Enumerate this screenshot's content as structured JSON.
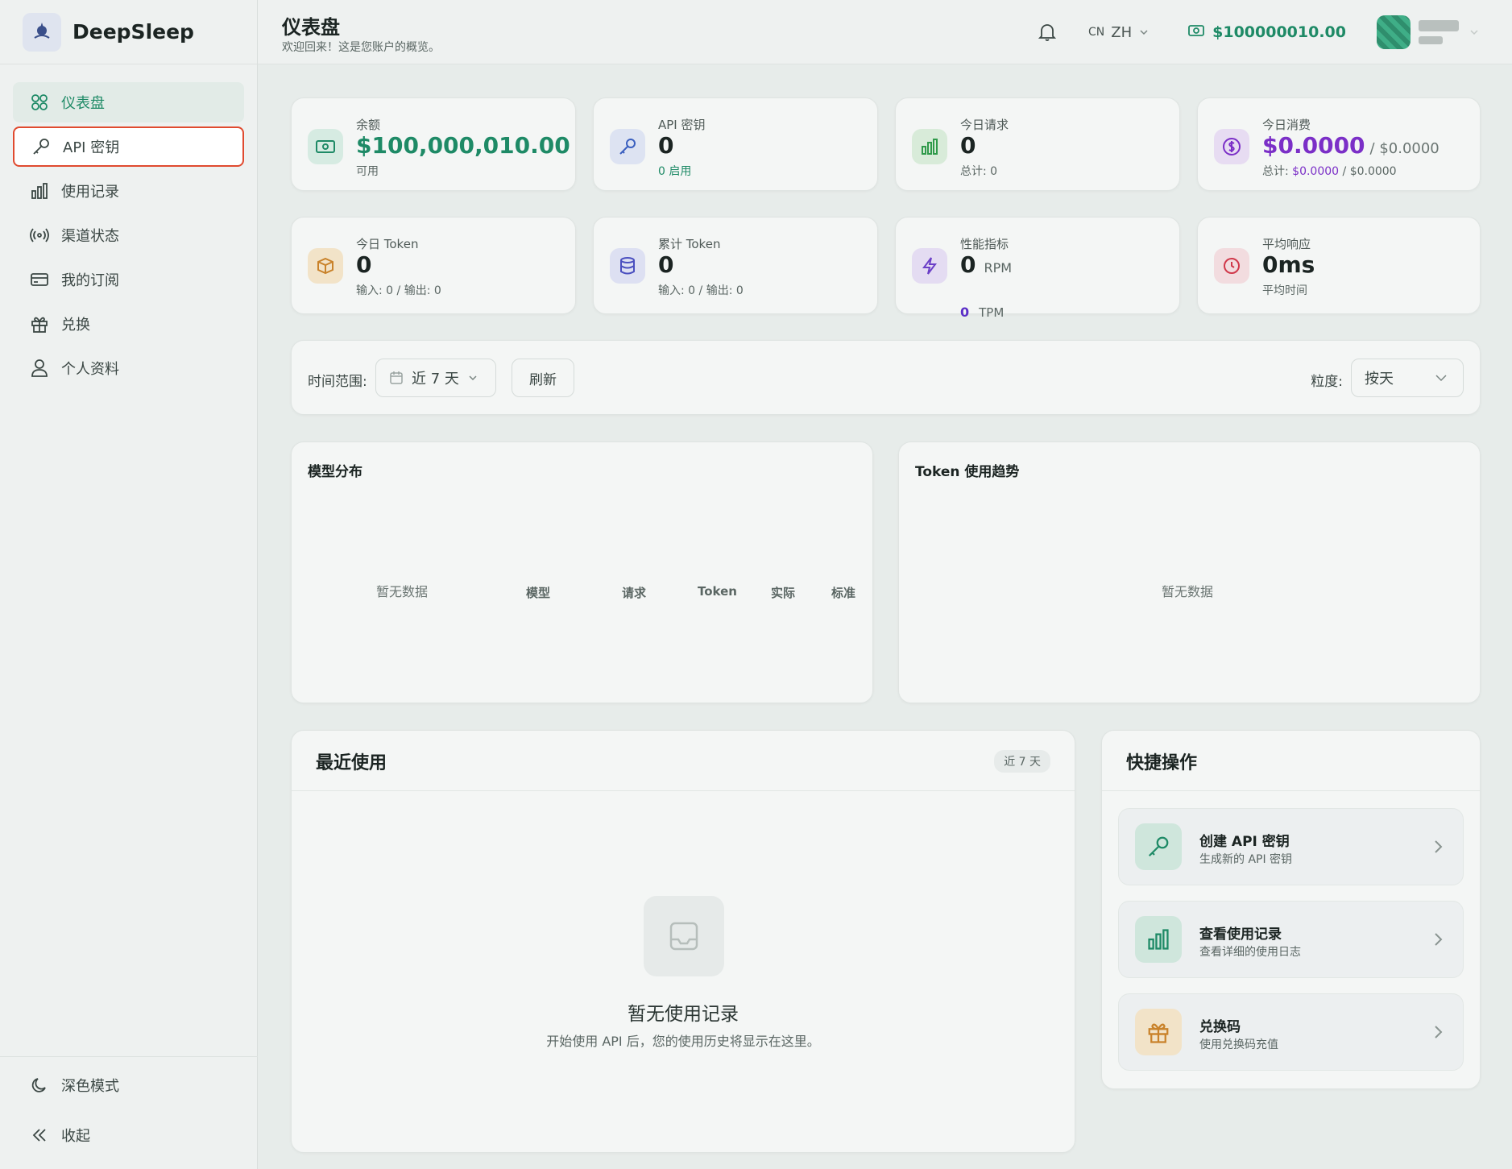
{
  "app": {
    "name": "DeepSleep"
  },
  "sidebar": {
    "items": [
      {
        "label": "仪表盘"
      },
      {
        "label": "API 密钥"
      },
      {
        "label": "使用记录"
      },
      {
        "label": "渠道状态"
      },
      {
        "label": "我的订阅"
      },
      {
        "label": "兑换"
      },
      {
        "label": "个人资料"
      }
    ],
    "bottom": {
      "dark_mode": "深色模式",
      "collapse": "收起"
    }
  },
  "header": {
    "title": "仪表盘",
    "subtitle": "欢迎回来！这是您账户的概览。",
    "lang_code": "CN",
    "lang": "ZH",
    "balance": "$100000010.00"
  },
  "stats": {
    "balance": {
      "label": "余额",
      "value": "$100,000,010.00",
      "sub": "可用"
    },
    "api_keys": {
      "label": "API 密钥",
      "value": "0",
      "sub": "0 启用"
    },
    "today_requests": {
      "label": "今日请求",
      "value": "0",
      "sub": "总计: 0"
    },
    "today_cost": {
      "label": "今日消费",
      "value": "$0.0000",
      "suffix": "/ $0.0000",
      "sub_prefix": "总计:",
      "sub_value": "$0.0000",
      "sub_suffix": "/ $0.0000"
    },
    "today_token": {
      "label": "今日 Token",
      "value": "0",
      "sub": "输入: 0 / 输出: 0"
    },
    "total_token": {
      "label": "累计 Token",
      "value": "0",
      "sub": "输入: 0 / 输出: 0"
    },
    "performance": {
      "label": "性能指标",
      "rpm_value": "0",
      "rpm_unit": "RPM",
      "tpm_value": "0",
      "tpm_unit": "TPM"
    },
    "avg_response": {
      "label": "平均响应",
      "value": "0ms",
      "sub": "平均时间"
    }
  },
  "filter": {
    "range_label": "时间范围:",
    "range_value": "近 7 天",
    "refresh": "刷新",
    "granularity_label": "粒度:",
    "granularity_value": "按天"
  },
  "model_dist": {
    "title": "模型分布",
    "empty": "暂无数据",
    "columns": [
      "模型",
      "请求",
      "Token",
      "实际",
      "标准"
    ]
  },
  "token_trend": {
    "title": "Token 使用趋势",
    "empty": "暂无数据"
  },
  "recent": {
    "title": "最近使用",
    "chip": "近 7 天",
    "empty_title": "暂无使用记录",
    "empty_sub": "开始使用 API 后，您的使用历史将显示在这里。"
  },
  "quick": {
    "title": "快捷操作",
    "items": [
      {
        "title": "创建 API 密钥",
        "sub": "生成新的 API 密钥"
      },
      {
        "title": "查看使用记录",
        "sub": "查看详细的使用日志"
      },
      {
        "title": "兑换码",
        "sub": "使用兑换码充值"
      }
    ]
  },
  "colors": {
    "accent": "#1e8a66",
    "purple": "#7b2fc7",
    "highlight_border": "#e04a2f"
  }
}
